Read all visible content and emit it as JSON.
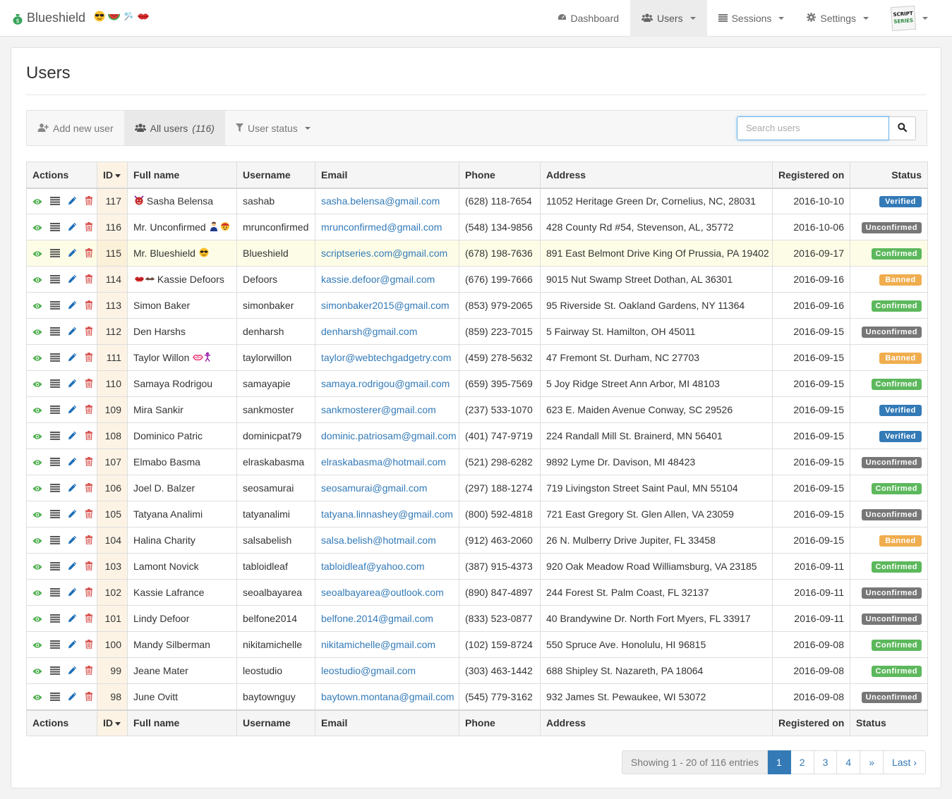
{
  "brand": {
    "name": "Blueshield"
  },
  "nav": {
    "items": [
      {
        "label": "Dashboard",
        "icon": "dashboard-icon"
      },
      {
        "label": "Users",
        "icon": "users-icon"
      },
      {
        "label": "Sessions",
        "icon": "list-icon"
      },
      {
        "label": "Settings",
        "icon": "gear-icon"
      }
    ],
    "profile_logo": {
      "line1": "SCRIPT",
      "line2": "SERIES"
    }
  },
  "page": {
    "title": "Users"
  },
  "toolbar": {
    "add_label": "Add new user",
    "all_users_label": "All users",
    "all_users_count": "(116)",
    "status_label": "User status",
    "search_placeholder": "Search users"
  },
  "table": {
    "headers": [
      "Actions",
      "ID",
      "Full name",
      "Username",
      "Email",
      "Phone",
      "Address",
      "Registered on",
      "Status"
    ],
    "rows": [
      {
        "id": "117",
        "name": "Sasha Belensa",
        "pre": [
          "devil"
        ],
        "post": [],
        "username": "sashab",
        "email": "sasha.belensa@gmail.com",
        "phone": "(628) 118-7654",
        "address": "11052 Heritage Green Dr, Cornelius, NC, 28031",
        "date": "2016-10-10",
        "status": "Verified"
      },
      {
        "id": "116",
        "name": "Mr. Unconfirmed",
        "pre": [],
        "post": [
          "man",
          "face-red"
        ],
        "username": "mrunconfirmed",
        "email": "mrunconfirmed@gmail.com",
        "phone": "(548) 134-9856",
        "address": "428 County Rd #54, Stevenson, AL, 35772",
        "date": "2016-10-06",
        "status": "Unconfirmed"
      },
      {
        "id": "115",
        "name": "Mr. Blueshield",
        "pre": [],
        "post": [
          "sunglasses"
        ],
        "username": "Blueshield",
        "email": "scriptseries.com@gmail.com",
        "phone": "(678) 198-7636",
        "address": "891 East Belmont Drive King Of Prussia, PA 19402",
        "date": "2016-09-17",
        "status": "Confirmed",
        "highlight": true
      },
      {
        "id": "114",
        "name": "Kassie Defoors",
        "pre": [
          "lips",
          "mustache"
        ],
        "post": [],
        "username": "Defoors",
        "email": "kassie.defoor@gmail.com",
        "phone": "(676) 199-7666",
        "address": "9015 Nut Swamp Street Dothan, AL 36301",
        "date": "2016-09-16",
        "status": "Banned"
      },
      {
        "id": "113",
        "name": "Simon Baker",
        "pre": [],
        "post": [],
        "username": "simonbaker",
        "email": "simonbaker2015@gmail.com",
        "phone": "(853) 979-2065",
        "address": "95 Riverside St. Oakland Gardens, NY 11364",
        "date": "2016-09-16",
        "status": "Confirmed"
      },
      {
        "id": "112",
        "name": "Den Harshs",
        "pre": [],
        "post": [],
        "username": "denharsh",
        "email": "denharsh@gmail.com",
        "phone": "(859) 223-7015",
        "address": "5 Fairway St. Hamilton, OH 45011",
        "date": "2016-09-15",
        "status": "Unconfirmed"
      },
      {
        "id": "111",
        "name": "Taylor Willon",
        "pre": [],
        "post": [
          "kiss",
          "dancer"
        ],
        "username": "taylorwillon",
        "email": "taylor@webtechgadgetry.com",
        "phone": "(459) 278-5632",
        "address": "47 Fremont St. Durham, NC 27703",
        "date": "2016-09-15",
        "status": "Banned"
      },
      {
        "id": "110",
        "name": "Samaya Rodrigou",
        "pre": [],
        "post": [],
        "username": "samayapie",
        "email": "samaya.rodrigou@gmail.com",
        "phone": "(659) 395-7569",
        "address": "5 Joy Ridge Street Ann Arbor, MI 48103",
        "date": "2016-09-15",
        "status": "Confirmed"
      },
      {
        "id": "109",
        "name": "Mira Sankir",
        "pre": [],
        "post": [],
        "username": "sankmoster",
        "email": "sankmosterer@gmail.com",
        "phone": "(237) 533-1070",
        "address": "623 E. Maiden Avenue Conway, SC 29526",
        "date": "2016-09-15",
        "status": "Verified"
      },
      {
        "id": "108",
        "name": "Dominico Patric",
        "pre": [],
        "post": [],
        "username": "dominicpat79",
        "email": "dominic.patriosam@gmail.com",
        "phone": "(401) 747-9719",
        "address": "224 Randall Mill St. Brainerd, MN 56401",
        "date": "2016-09-15",
        "status": "Verified"
      },
      {
        "id": "107",
        "name": "Elmabo Basma",
        "pre": [],
        "post": [],
        "username": "elraskabasma",
        "email": "elraskabasma@hotmail.com",
        "phone": "(521) 298-6282",
        "address": "9892 Lyme Dr. Davison, MI 48423",
        "date": "2016-09-15",
        "status": "Unconfirmed"
      },
      {
        "id": "106",
        "name": "Joel D. Balzer",
        "pre": [],
        "post": [],
        "username": "seosamurai",
        "email": "seosamurai@gmail.com",
        "phone": "(297) 188-1274",
        "address": "719 Livingston Street Saint Paul, MN 55104",
        "date": "2016-09-15",
        "status": "Confirmed"
      },
      {
        "id": "105",
        "name": "Tatyana Analimi",
        "pre": [],
        "post": [],
        "username": "tatyanalimi",
        "email": "tatyana.linnashey@gmail.com",
        "phone": "(800) 592-4818",
        "address": "721 East Gregory St. Glen Allen, VA 23059",
        "date": "2016-09-15",
        "status": "Unconfirmed"
      },
      {
        "id": "104",
        "name": "Halina Charity",
        "pre": [],
        "post": [],
        "username": "salsabelish",
        "email": "salsa.belish@hotmail.com",
        "phone": "(912) 463-2060",
        "address": "26 N. Mulberry Drive Jupiter, FL 33458",
        "date": "2016-09-15",
        "status": "Banned"
      },
      {
        "id": "103",
        "name": "Lamont Novick",
        "pre": [],
        "post": [],
        "username": "tabloidleaf",
        "email": "tabloidleaf@yahoo.com",
        "phone": "(387) 915-4373",
        "address": "920 Oak Meadow Road Williamsburg, VA 23185",
        "date": "2016-09-11",
        "status": "Confirmed"
      },
      {
        "id": "102",
        "name": "Kassie Lafrance",
        "pre": [],
        "post": [],
        "username": "seoalbayarea",
        "email": "seoalbayarea@outlook.com",
        "phone": "(890) 847-4897",
        "address": "244 Forest St. Palm Coast, FL 32137",
        "date": "2016-09-11",
        "status": "Unconfirmed"
      },
      {
        "id": "101",
        "name": "Lindy Defoor",
        "pre": [],
        "post": [],
        "username": "belfone2014",
        "email": "belfone.2014@gmail.com",
        "phone": "(833) 523-0877",
        "address": "40 Brandywine Dr. North Fort Myers, FL 33917",
        "date": "2016-09-11",
        "status": "Unconfirmed"
      },
      {
        "id": "100",
        "name": "Mandy Silberman",
        "pre": [],
        "post": [],
        "username": "nikitamichelle",
        "email": "nikitamichelle@gmail.com",
        "phone": "(102) 159-8724",
        "address": "550 Spruce Ave. Honolulu, HI 96815",
        "date": "2016-09-08",
        "status": "Confirmed"
      },
      {
        "id": "99",
        "name": "Jeane Mater",
        "pre": [],
        "post": [],
        "username": "leostudio",
        "email": "leostudio@gmail.com",
        "phone": "(303) 463-1442",
        "address": "688 Shipley St. Nazareth, PA 18064",
        "date": "2016-09-08",
        "status": "Confirmed"
      },
      {
        "id": "98",
        "name": "June Ovitt",
        "pre": [],
        "post": [],
        "username": "baytownguy",
        "email": "baytown.montana@gmail.com",
        "phone": "(545) 779-3162",
        "address": "932 James St. Pewaukee, WI 53072",
        "date": "2016-09-08",
        "status": "Unconfirmed"
      }
    ]
  },
  "status_colors": {
    "Verified": "#337ab7",
    "Unconfirmed": "#777777",
    "Confirmed": "#5cb85c",
    "Banned": "#f0ad4e"
  },
  "pagination": {
    "info": "Showing 1 - 20 of 116 entries",
    "pages": [
      "1",
      "2",
      "3",
      "4"
    ],
    "next": "»",
    "last": "Last ›",
    "active": "1"
  }
}
